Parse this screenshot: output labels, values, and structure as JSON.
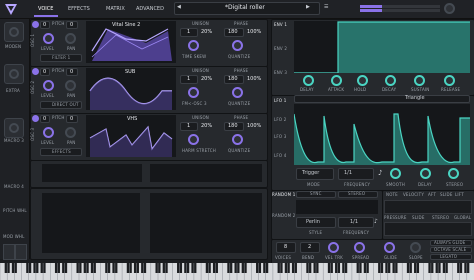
{
  "header": {
    "tabs": [
      "VOICE",
      "EFFECTS",
      "MATRIX",
      "ADVANCED"
    ],
    "preset_name": "*Digital roller"
  },
  "sidebar": {
    "items": [
      "MODEN",
      "EXTRA",
      "MACRO 3",
      "MACRO 4",
      "PITCH WHL",
      "MOD WHL"
    ]
  },
  "oscillators": [
    {
      "id": "OSC 1",
      "wavetable_name": "Vital Sine 2",
      "octave": "0",
      "semitone": "0",
      "mode_label": "FILTER 1",
      "direct_out": "",
      "unison_label": "UNISON",
      "unison_value": "1",
      "unison_percent": "20%",
      "phase_label": "PHASE",
      "phase_value": "180",
      "phase_percent": "100%",
      "knob_labels": [
        "PITCH",
        "LEVEL",
        "PAN"
      ],
      "bottom_labels": [
        "TIME SKEW",
        "QUANTIZE"
      ]
    },
    {
      "id": "OSC 2",
      "wavetable_name": "SUB",
      "octave": "0",
      "semitone": "0",
      "mode_label": "DIRECT OUT",
      "unison_label": "UNISON",
      "unison_value": "1",
      "unison_percent": "20%",
      "phase_label": "PHASE",
      "phase_value": "180",
      "phase_percent": "100%",
      "knob_labels": [
        "PITCH",
        "LEVEL",
        "PAN"
      ],
      "bottom_labels": [
        "FM<-OSC 3",
        "QUANTIZE"
      ]
    },
    {
      "id": "OSC 3",
      "wavetable_name": "VHS",
      "octave": "0",
      "semitone": "0",
      "mode_label": "EFFECTS",
      "unison_label": "UNISON",
      "unison_value": "1",
      "unison_percent": "20%",
      "phase_label": "PHASE",
      "phase_value": "180",
      "phase_percent": "100%",
      "knob_labels": [
        "PITCH",
        "LEVEL",
        "PAN"
      ],
      "bottom_labels": [
        "HARM STRETCH",
        "QUANTIZE"
      ]
    }
  ],
  "envelope": {
    "tabs": [
      "ENV 1",
      "ENV 2",
      "ENV 3"
    ],
    "knob_labels": [
      "DELAY",
      "ATTACK",
      "HOLD",
      "DECAY",
      "SUSTAIN",
      "RELEASE"
    ]
  },
  "lfo": {
    "tabs": [
      "LFO 1",
      "LFO 2",
      "LFO 3",
      "LFO 4"
    ],
    "shape_name": "Triangle",
    "trigger": "Trigger",
    "frequency_value": "1/1",
    "labels": [
      "MODE",
      "FREQUENCY",
      "SMOOTH",
      "DELAY",
      "STEREO"
    ]
  },
  "random": {
    "tabs": [
      "RANDOM 1",
      "RANDOM 2"
    ],
    "sync_label": "SYNC",
    "stereo_label": "STEREO",
    "style_value": "Perlin",
    "style_label": "STYLE",
    "frequency_value": "1/1",
    "frequency_label": "FREQUENCY"
  },
  "mpe": {
    "headers": [
      "NOTE",
      "VELOCITY",
      "AFT",
      "SLIDE",
      "LIFT",
      "PRESSURE"
    ],
    "labels": [
      "PRESSURE",
      "SLIDE",
      "STEREO",
      "GLOBAL"
    ]
  },
  "voice": {
    "values": [
      "8",
      "2"
    ],
    "labels": [
      "VOICES",
      "BEND",
      "VEL TRK",
      "SPREAD",
      "GLIDE",
      "SLOPE"
    ],
    "glide_options": [
      "ALWAYS GLIDE",
      "OCTAVE SCALE",
      "LEGATO"
    ]
  },
  "colors": {
    "accent": "#8a72e8",
    "teal": "#4ad4c2",
    "bg": "#1b1d20",
    "panel": "#26292d"
  }
}
